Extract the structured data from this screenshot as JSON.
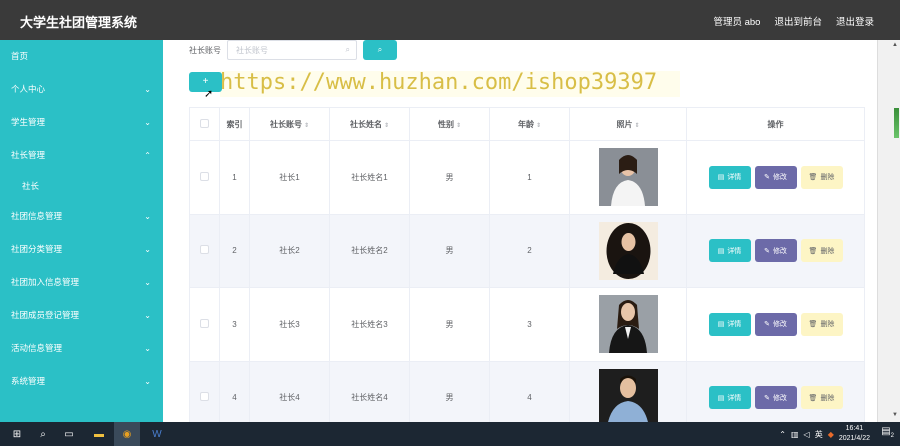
{
  "app_title": "大学生社团管理系统",
  "header": {
    "admin_label": "管理员 abo",
    "back_to_front": "退出到前台",
    "logout": "退出登录"
  },
  "sidebar": {
    "items": [
      {
        "label": "首页",
        "chevron": ""
      },
      {
        "label": "个人中心",
        "chevron": "⌄"
      },
      {
        "label": "学生管理",
        "chevron": "⌄"
      },
      {
        "label": "社长管理",
        "chevron": "⌃"
      },
      {
        "label": "社长",
        "chevron": ""
      },
      {
        "label": "社团信息管理",
        "chevron": "⌄"
      },
      {
        "label": "社团分类管理",
        "chevron": "⌄"
      },
      {
        "label": "社团加入信息管理",
        "chevron": "⌄"
      },
      {
        "label": "社团成员登记管理",
        "chevron": "⌄"
      },
      {
        "label": "活动信息管理",
        "chevron": "⌄"
      },
      {
        "label": "系统管理",
        "chevron": "⌄"
      }
    ]
  },
  "search": {
    "label": "社长账号",
    "placeholder": "社长账号",
    "search_icon": "search-icon"
  },
  "toolbar": {
    "add_label": "+"
  },
  "watermark": "https://www.huzhan.com/ishop39397",
  "table": {
    "headers": {
      "index": "索引",
      "account": "社长账号",
      "name": "社长姓名",
      "gender": "性别",
      "age": "年龄",
      "photo": "照片",
      "actions": "操作"
    },
    "rows": [
      {
        "index": "1",
        "account": "社长1",
        "name": "社长姓名1",
        "gender": "男",
        "age": "1"
      },
      {
        "index": "2",
        "account": "社长2",
        "name": "社长姓名2",
        "gender": "男",
        "age": "2"
      },
      {
        "index": "3",
        "account": "社长3",
        "name": "社长姓名3",
        "gender": "男",
        "age": "3"
      },
      {
        "index": "4",
        "account": "社长4",
        "name": "社长姓名4",
        "gender": "男",
        "age": "4"
      }
    ],
    "actions": {
      "detail": "详情",
      "edit": "修改",
      "delete": "删除"
    }
  },
  "colors": {
    "accent": "#2bc0c6",
    "topbar": "#3a3a3a",
    "edit": "#6c6aa8",
    "delete": "#fdf5c5"
  },
  "taskbar": {
    "ime": "英",
    "time": "16:41",
    "date": "2021/4/22",
    "notification_count": "2"
  }
}
